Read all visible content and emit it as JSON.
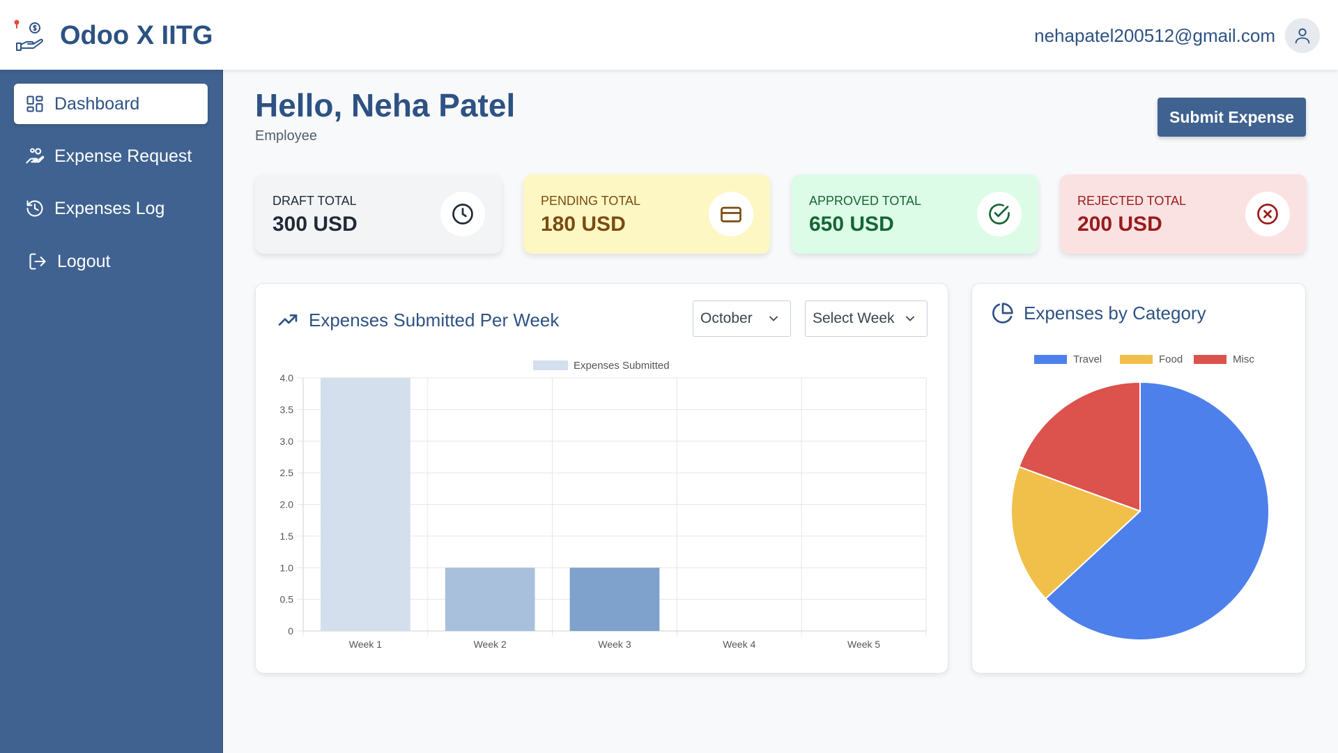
{
  "header": {
    "brand": "Odoo X IITG",
    "user_email": "nehapatel200512@gmail.com"
  },
  "sidebar": {
    "items": [
      {
        "label": "Dashboard",
        "icon": "dashboard-icon",
        "active": true
      },
      {
        "label": "Expense Request",
        "icon": "hand-coins-icon",
        "active": false
      },
      {
        "label": "Expenses Log",
        "icon": "history-icon",
        "active": false
      },
      {
        "label": "Logout",
        "icon": "logout-icon",
        "active": false
      }
    ]
  },
  "main": {
    "greeting": "Hello, Neha Patel",
    "role": "Employee",
    "submit_label": "Submit Expense",
    "stats": [
      {
        "label": "DRAFT TOTAL",
        "value": "300 USD",
        "icon": "clock-icon"
      },
      {
        "label": "PENDING TOTAL",
        "value": "180 USD",
        "icon": "credit-card-icon"
      },
      {
        "label": "APPROVED TOTAL",
        "value": "650 USD",
        "icon": "check-circle-icon"
      },
      {
        "label": "REJECTED TOTAL",
        "value": "200 USD",
        "icon": "x-circle-icon"
      }
    ],
    "weekly_card": {
      "title": "Expenses Submitted Per Week",
      "month_select": "October",
      "week_select": "Select Week"
    },
    "category_card": {
      "title": "Expenses by Category"
    }
  },
  "chart_data": [
    {
      "type": "bar",
      "categories": [
        "Week 1",
        "Week 2",
        "Week 3",
        "Week 4",
        "Week 5"
      ],
      "series": [
        {
          "name": "Expenses Submitted",
          "values": [
            4,
            1,
            1,
            0,
            0
          ]
        }
      ],
      "bar_colors": [
        "#d3dfec",
        "#a8c0dc",
        "#7ea2cb"
      ],
      "ylim": [
        0,
        4
      ],
      "yticks": [
        "0",
        "0.5",
        "1.0",
        "1.5",
        "2.0",
        "2.5",
        "3.0",
        "3.5",
        "4.0"
      ],
      "grid": true,
      "legend": "top"
    },
    {
      "type": "pie",
      "labels": [
        "Travel",
        "Food",
        "Misc"
      ],
      "values": [
        650,
        180,
        200
      ],
      "colors": [
        "#4e80eb",
        "#f0c04b",
        "#dc524c"
      ],
      "legend": "top"
    }
  ]
}
